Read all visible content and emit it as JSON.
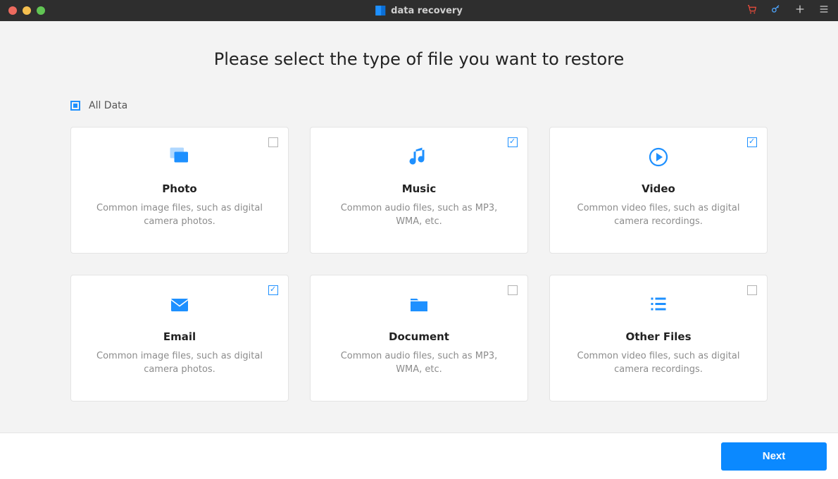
{
  "titlebar": {
    "app_name": "data recovery"
  },
  "heading": "Please select the type of file you want to restore",
  "all_data": {
    "label": "All Data",
    "state": "indeterminate"
  },
  "cards": [
    {
      "id": "photo",
      "title": "Photo",
      "desc": "Common image files, such as digital camera photos.",
      "checked": false,
      "icon": "photo-icon"
    },
    {
      "id": "music",
      "title": "Music",
      "desc": "Common audio files, such as MP3, WMA, etc.",
      "checked": true,
      "icon": "music-icon"
    },
    {
      "id": "video",
      "title": "Video",
      "desc": "Common video files, such as digital camera recordings.",
      "checked": true,
      "icon": "video-icon"
    },
    {
      "id": "email",
      "title": "Email",
      "desc": "Common image files, such as digital camera photos.",
      "checked": true,
      "icon": "email-icon"
    },
    {
      "id": "document",
      "title": "Document",
      "desc": "Common audio files, such as MP3, WMA, etc.",
      "checked": false,
      "icon": "document-icon"
    },
    {
      "id": "other",
      "title": "Other Files",
      "desc": "Common video files, such as digital camera recordings.",
      "checked": false,
      "icon": "list-icon"
    }
  ],
  "footer": {
    "next_label": "Next"
  }
}
